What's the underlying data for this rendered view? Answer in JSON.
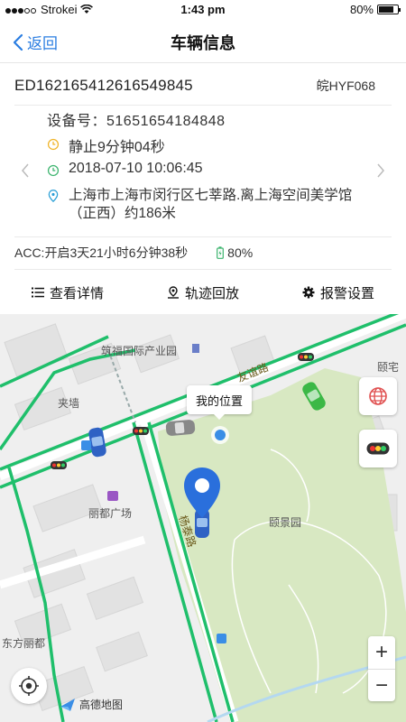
{
  "status_bar": {
    "carrier": "Strokei",
    "time": "1:43 pm",
    "battery": "80%"
  },
  "nav": {
    "back_label": "返回",
    "title": "车辆信息"
  },
  "vehicle": {
    "id": "ED162165412616549845",
    "plate": "皖HYF068",
    "device_label": "设备号：51651654184848",
    "stop_status": "静止9分钟04秒",
    "datetime": "2018-07-10 10:06:45",
    "address": "上海市上海市闵行区七莘路.离上海空间美学馆（正西）约186米",
    "acc": "ACC:开启3天21小时6分钟38秒",
    "battery": "80%"
  },
  "actions": [
    {
      "label": "查看详情",
      "icon": "list-icon"
    },
    {
      "label": "轨迹回放",
      "icon": "track-icon"
    },
    {
      "label": "报警设置",
      "icon": "gear-icon"
    }
  ],
  "map": {
    "my_location_label": "我的位置",
    "labels": {
      "industrial_park": "筑福国际产业园",
      "jiaxiang": "夹墙",
      "lidu": "丽都广场",
      "yijing": "颐景园",
      "yizhai": "颐宅",
      "dongfang": "东方丽都",
      "road_youyi": "友谊路",
      "road_yangtai": "杨泰路"
    },
    "zoom_in": "+",
    "zoom_out": "−",
    "provider": "高德地图"
  },
  "colors": {
    "accent": "#2a7de1",
    "road_green": "#1fbf6b",
    "park": "#d8e8c2",
    "stop_icon": "#f0b429",
    "time_icon": "#3cb46e",
    "location_icon": "#2a9fd6"
  }
}
